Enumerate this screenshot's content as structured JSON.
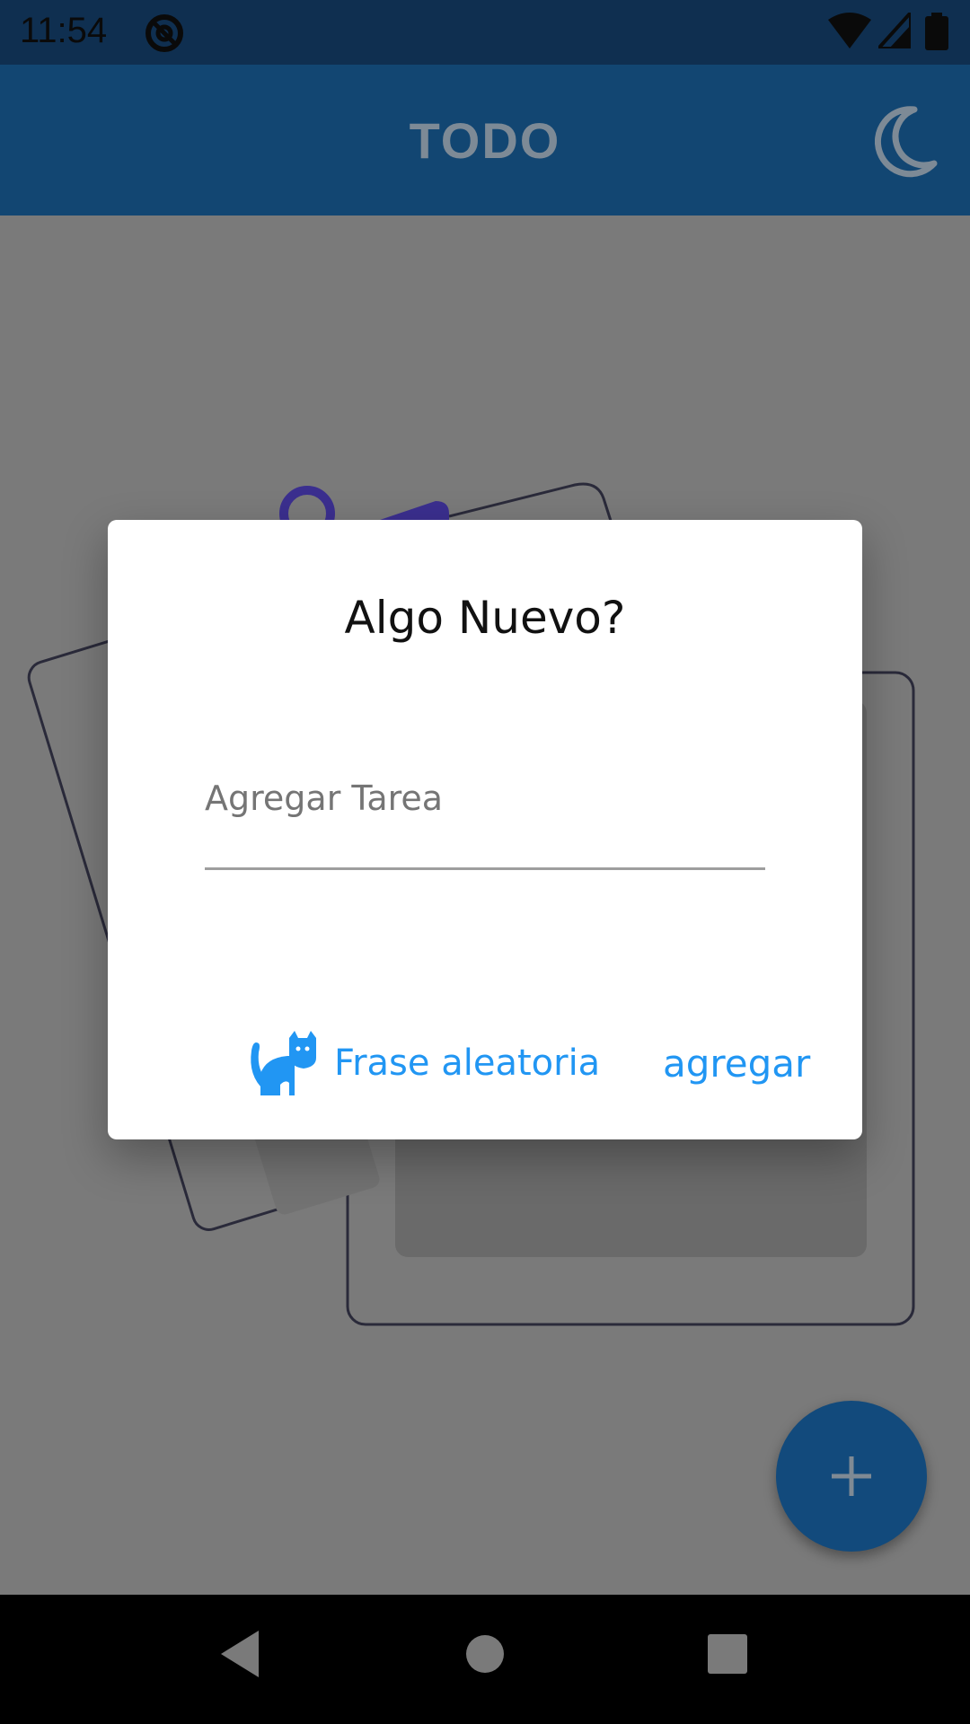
{
  "status_bar": {
    "time": "11:54",
    "icons": [
      "at-sign-icon",
      "wifi-icon",
      "signal-icon",
      "battery-icon"
    ]
  },
  "app_bar": {
    "title": "TODO",
    "theme_toggle_icon": "moon-icon"
  },
  "dialog": {
    "title": "Algo Nuevo?",
    "input_placeholder": "Agregar Tarea",
    "input_value": "",
    "random_phrase_label": "Frase aleatoria",
    "random_phrase_icon": "cat-icon",
    "add_label": "agregar"
  },
  "fab": {
    "icon": "plus-icon"
  },
  "colors": {
    "app_bar": "#124672",
    "accent": "#2196f3",
    "scrim": "#7a7a7a"
  },
  "nav_bar": {
    "buttons": [
      "back-icon",
      "home-icon",
      "recents-icon"
    ]
  }
}
